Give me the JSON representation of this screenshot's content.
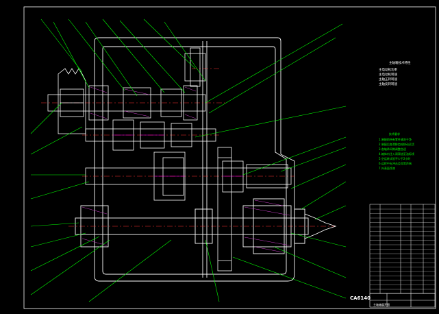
{
  "drawing": {
    "model_label": "CA6140",
    "tech_specs_lines": [
      "主轴箱技术特性",
      "主电动机功率",
      "主电动机转速",
      "主轴正转转速",
      "主轴反转转速"
    ],
    "tech_req_title": "技术要求",
    "tech_req_lines": [
      "1.装配前所有零件清洗干净",
      "2.装配后各滑移齿轮移动灵活",
      "3.各轴承间隙调整合适",
      "4.箱体内注入润滑油至油标线",
      "5.空运转试验不少于2小时",
      "6.运转中无冲击及异常声响",
      "7.外表面涂漆"
    ],
    "title_block_caption": "主轴箱展开图",
    "colors": {
      "background": "#000000",
      "outline": "#ffffff",
      "leader": "#00ff00",
      "centerline": "#ff3333",
      "hatch": "#d040d0",
      "gear_face": "#ff00ff",
      "text": "#ffffff"
    }
  }
}
